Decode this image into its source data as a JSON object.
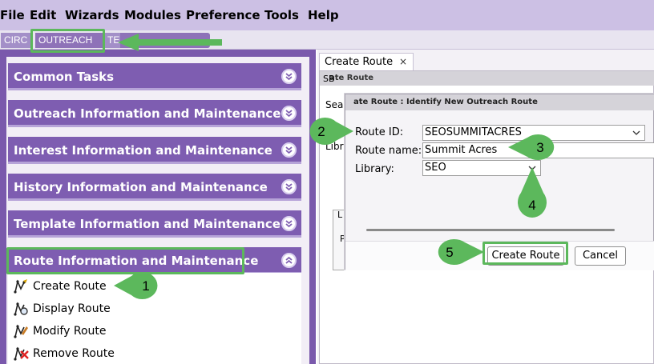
{
  "menubar": {
    "items": [
      "File",
      "Edit",
      "Wizards",
      "Modules",
      "Preference",
      "Tools",
      "Help"
    ]
  },
  "module_tabs": {
    "circ": "CIRC",
    "outreach": "OUTREACH",
    "partial": "TE"
  },
  "left_panel": {
    "sections": [
      {
        "title": "Common Tasks"
      },
      {
        "title": "Outreach Information and Maintenance"
      },
      {
        "title": "Interest Information and Maintenance"
      },
      {
        "title": "History Information and Maintenance"
      },
      {
        "title": "Template Information and Maintenance"
      },
      {
        "title": "Route Information and Maintenance"
      }
    ],
    "route_tasks": [
      {
        "label": "Create Route",
        "icon": "create-route-icon"
      },
      {
        "label": "Display Route",
        "icon": "display-route-icon"
      },
      {
        "label": "Modify Route",
        "icon": "modify-route-icon"
      },
      {
        "label": "Remove Route",
        "icon": "remove-route-icon"
      }
    ]
  },
  "workspace": {
    "doc_tab": {
      "label": "Create Route",
      "close": "×"
    },
    "outer_dialog": {
      "title": "ate Route",
      "frag_sb": "SB",
      "frag_sea": "Sea",
      "frag_sb2": "SB",
      "frag_l": "L",
      "frag_libr": "Libr",
      "frag_li": "Li",
      "frag_p": "P"
    },
    "inner_dialog": {
      "title": "ate Route : Identify New Outreach Route",
      "route_id_label": "Route ID:",
      "route_id_value": "SEOSUMMITACRES",
      "route_name_label": "Route name:",
      "route_name_value": "Summit Acres",
      "library_label": "Library:",
      "library_value": "SEO",
      "create_button": "Create Route",
      "cancel_button": "Cancel"
    }
  },
  "annotations": {
    "callouts": [
      "1",
      "2",
      "3",
      "4",
      "5"
    ],
    "color": "#5cb85c"
  }
}
